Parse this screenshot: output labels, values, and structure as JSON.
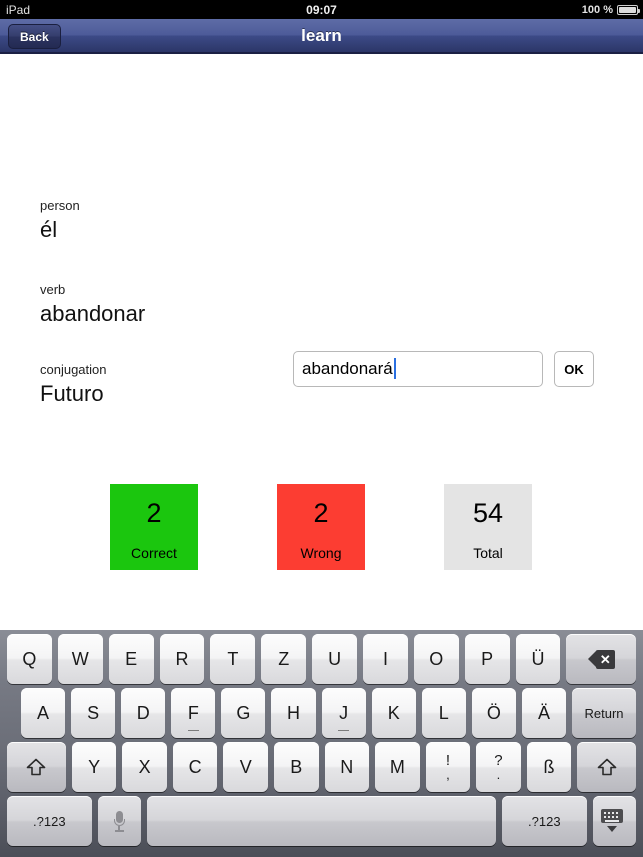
{
  "status_bar": {
    "device": "iPad",
    "time": "09:07",
    "battery_percent": "100 %",
    "battery_icon": "battery-full-icon"
  },
  "nav_bar": {
    "back_label": "Back",
    "title": "learn"
  },
  "exercise": {
    "person_label": "person",
    "person_value": "él",
    "verb_label": "verb",
    "verb_value": "abandonar",
    "conjugation_label": "conjugation",
    "conjugation_value": "Futuro",
    "answer_value": "abandonará",
    "answer_placeholder": "",
    "ok_label": "OK"
  },
  "scores": [
    {
      "value": "2",
      "caption": "Correct",
      "color": "#1bc60e"
    },
    {
      "value": "2",
      "caption": "Wrong",
      "color": "#fc3d32"
    },
    {
      "value": "54",
      "caption": "Total",
      "color": "#e4e4e4"
    }
  ],
  "keyboard": {
    "layout": "QWERTZ-German",
    "row1": [
      "Q",
      "W",
      "E",
      "R",
      "T",
      "Z",
      "U",
      "I",
      "O",
      "P",
      "Ü"
    ],
    "row1_backspace": "backspace-icon",
    "row2": [
      "A",
      "S",
      "D",
      "F",
      "G",
      "H",
      "J",
      "K",
      "L",
      "Ö",
      "Ä"
    ],
    "row2_return": "Return",
    "row3_shift_left": "shift-icon",
    "row3": [
      "Y",
      "X",
      "C",
      "V",
      "B",
      "N",
      "M"
    ],
    "row3_punct": [
      {
        "top": "!",
        "bot": ","
      },
      {
        "top": "?",
        "bot": "."
      }
    ],
    "row3_eszett": "ß",
    "row3_shift_right": "shift-icon",
    "row4_num_left": ".?123",
    "row4_mic": "microphone-icon",
    "row4_space": "",
    "row4_num_right": ".?123",
    "row4_hide": "hide-keyboard-icon"
  }
}
